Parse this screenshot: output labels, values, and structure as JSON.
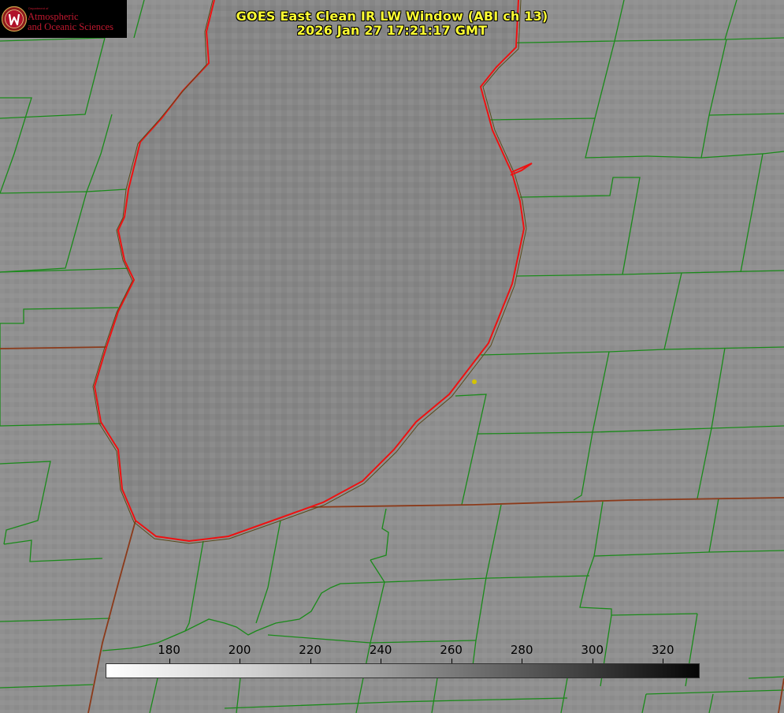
{
  "title": {
    "line1": "GOES East Clean IR LW Window (ABI ch 13)",
    "line2": "2026 Jan 27 17:21:17 GMT"
  },
  "logo": {
    "department": "Department of",
    "line1": "Atmospheric",
    "line2": "and Oceanic Sciences"
  },
  "colorbar": {
    "ticks": [
      "180",
      "200",
      "220",
      "240",
      "260",
      "280",
      "300",
      "320"
    ],
    "tick_values": [
      180,
      200,
      220,
      240,
      260,
      280,
      300,
      320
    ],
    "range": [
      162,
      330
    ],
    "colors": {
      "low": "#ffffff",
      "high": "#000000"
    }
  },
  "colors": {
    "background": "#8f8f8f",
    "lake": "#8a8a8a",
    "county_lines": "#1a8a1a",
    "state_lines": "#8b3a1a",
    "shoreline": "#ee1111",
    "title_text": "#ffff33",
    "marker": "#d4c400"
  }
}
